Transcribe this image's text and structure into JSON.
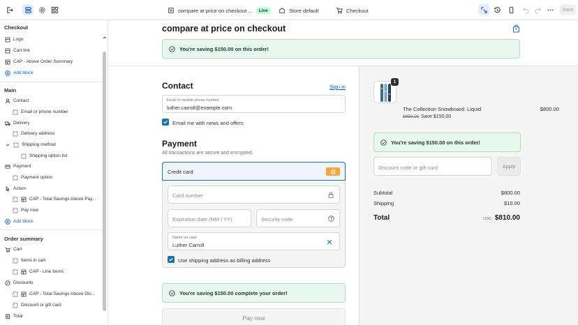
{
  "topbar": {
    "page_name": "compare at price on checkout ...",
    "status": "Live",
    "theme": "Store default",
    "template": "Checkout",
    "save_label": "Save"
  },
  "sidebar": {
    "checkout_header": "Checkout",
    "checkout_items": [
      "Logo",
      "Cart link",
      "CAP - Above Order Summary"
    ],
    "add_block": "Add block",
    "main_header": "Main",
    "main_items": {
      "contact": "Contact",
      "email_field": "Email or phone number",
      "delivery": "Delivery",
      "delivery_address": "Delivery address",
      "shipping_method": "Shipping method",
      "shipping_option_list": "Shipping option list",
      "payment": "Payment",
      "payment_option": "Payment option",
      "action": "Action",
      "cap_payment": "CAP - Total Savings Above Pay...",
      "pay_now": "Pay now"
    },
    "summary_header": "Order summary",
    "summary_items": {
      "cart": "Cart",
      "items_in_cart": "Items in cart",
      "cap_line_items": "CAP - Line Items",
      "discounts": "Discounts",
      "cap_discounts": "CAP - Total Savings Above Dis...",
      "discount_code": "Discount or gift card",
      "total": "Total"
    }
  },
  "checkout": {
    "page_title": "compare at price on checkout",
    "top_banner": "You're saving $150.00 on this order!",
    "contact_title": "Contact",
    "sign_in": "Sign in",
    "email_label": "Email or mobile phone number",
    "email_value": "luther.carroll@example.com",
    "news_label": "Email me with news and offers",
    "payment_title": "Payment",
    "payment_sub": "All transactions are secure and encrypted.",
    "credit_card": "Credit card",
    "card_number_ph": "Card number",
    "expiry_ph": "Expiration date (MM / YY)",
    "cvv_ph": "Security code",
    "name_label": "Name on card",
    "name_value": "Luther Carroll",
    "billing_label": "Use shipping address as billing address",
    "pay_banner": "You're saving $150.00 complete your order!",
    "pay_now": "Pay now"
  },
  "summary": {
    "product_qty": "1",
    "product_name": "The Collection Snowboard: Liquid",
    "compare_price": "$950.00",
    "save_text": "Save $150.00",
    "product_price": "$800.00",
    "banner": "You're saving $150.00 on this order!",
    "discount_ph": "Discount code or gift card",
    "apply": "Apply",
    "subtotal_label": "Subtotal",
    "subtotal_value": "$800.00",
    "shipping_label": "Shipping",
    "shipping_value": "$10.00",
    "total_label": "Total",
    "currency": "USD",
    "total_value": "$810.00"
  },
  "colors": {
    "accent": "#005bd3",
    "banner_bg": "#e9f8ee",
    "checkbox": "#1773b0",
    "card_badge": "#f0a93b"
  },
  "icons": [
    "exit-icon",
    "sections-icon",
    "gear-icon",
    "apps-icon",
    "page-icon",
    "theme-icon",
    "cart-icon",
    "inspector-icon",
    "history-icon",
    "mobile-icon",
    "undo-icon",
    "redo-icon",
    "more-icon",
    "bag-icon",
    "check-circle-icon",
    "lock-icon",
    "question-icon",
    "close-icon"
  ]
}
